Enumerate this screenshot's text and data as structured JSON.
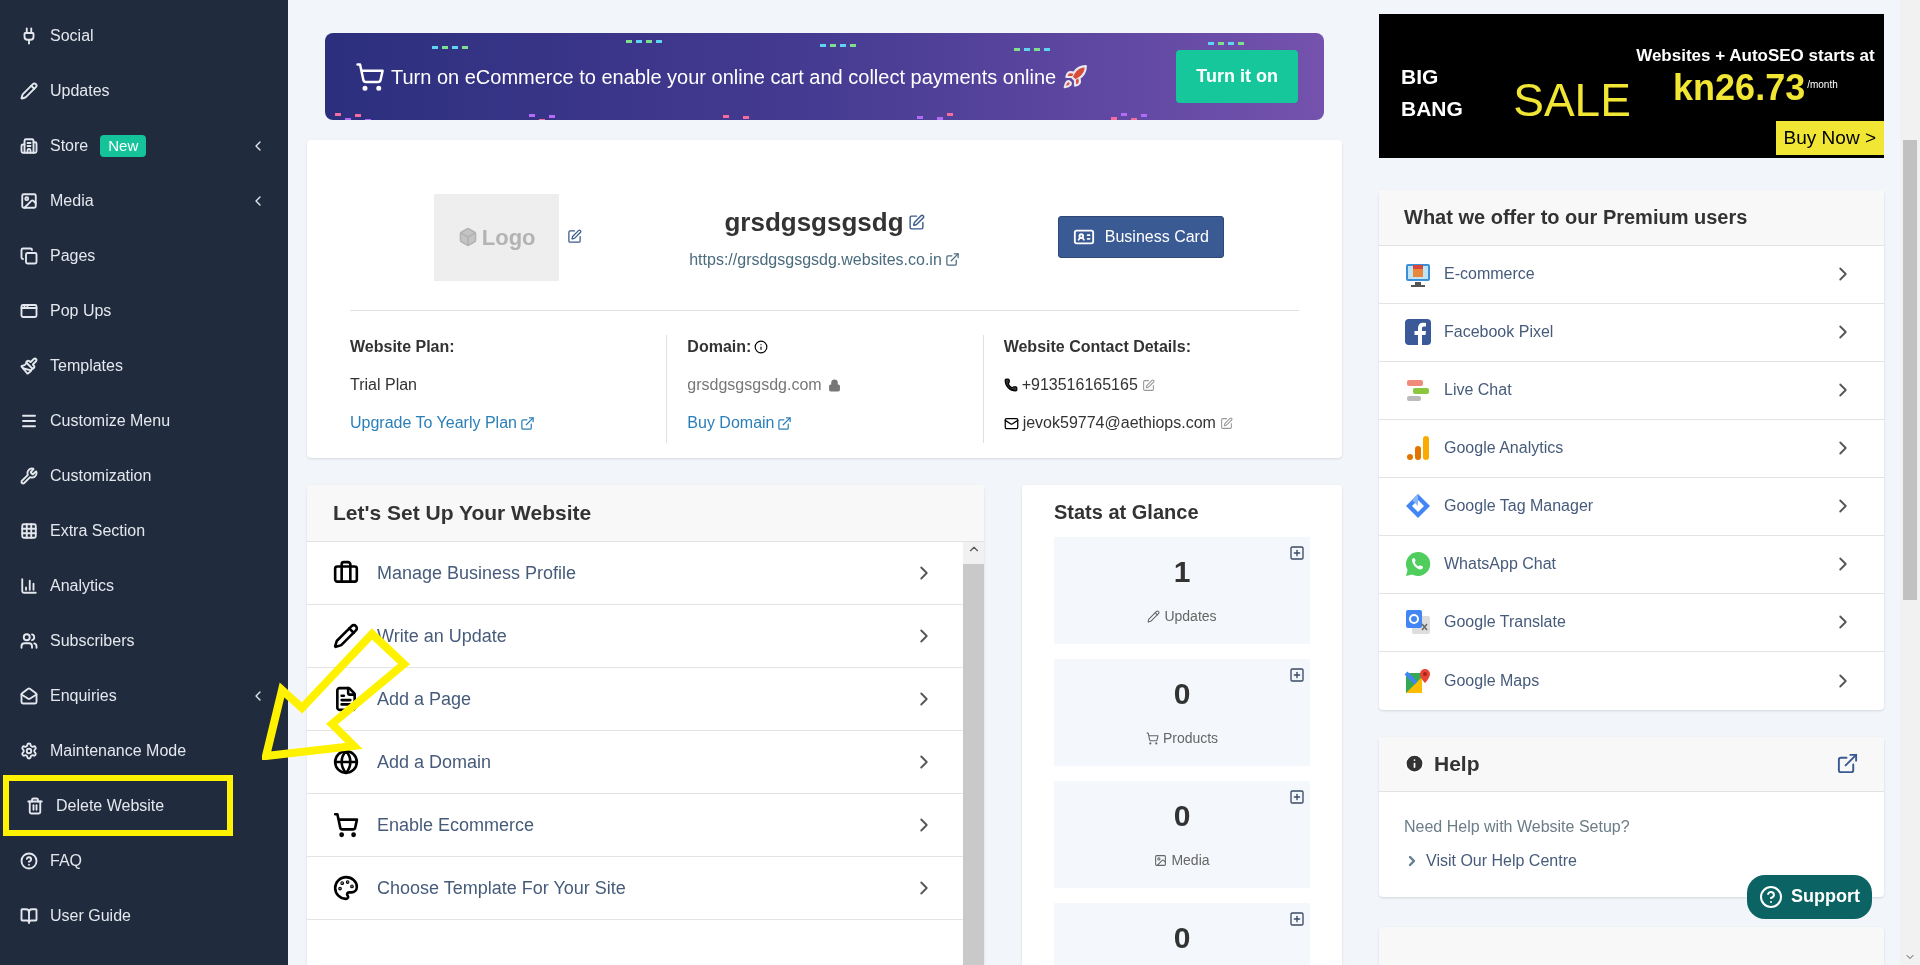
{
  "sidebar": {
    "items": [
      {
        "label": "Social",
        "has_submenu": false,
        "highlighted": false
      },
      {
        "label": "Updates",
        "has_submenu": false,
        "highlighted": false
      },
      {
        "label": "Store",
        "badge": "New",
        "has_submenu": true,
        "highlighted": false
      },
      {
        "label": "Media",
        "has_submenu": true,
        "highlighted": false
      },
      {
        "label": "Pages",
        "has_submenu": false,
        "highlighted": false
      },
      {
        "label": "Pop Ups",
        "has_submenu": false,
        "highlighted": false
      },
      {
        "label": "Templates",
        "has_submenu": false,
        "highlighted": false
      },
      {
        "label": "Customize Menu",
        "has_submenu": false,
        "highlighted": false
      },
      {
        "label": "Customization",
        "has_submenu": false,
        "highlighted": false
      },
      {
        "label": "Extra Section",
        "has_submenu": false,
        "highlighted": false
      },
      {
        "label": "Analytics",
        "has_submenu": false,
        "highlighted": false
      },
      {
        "label": "Subscribers",
        "has_submenu": false,
        "highlighted": false
      },
      {
        "label": "Enquiries",
        "has_submenu": true,
        "highlighted": false
      },
      {
        "label": "Maintenance Mode",
        "has_submenu": false,
        "highlighted": false
      },
      {
        "label": "Delete Website",
        "has_submenu": false,
        "highlighted": true
      },
      {
        "label": "FAQ",
        "has_submenu": false,
        "highlighted": false
      },
      {
        "label": "User Guide",
        "has_submenu": false,
        "highlighted": false
      }
    ]
  },
  "ecommerce_banner": {
    "text": "Turn on eCommerce to enable your online cart and collect payments online",
    "button": "Turn it on"
  },
  "site_card": {
    "logo": "Logo",
    "name": "grsdgsgsgsdg",
    "url": "https://grsdgsgsgsdg.websites.co.in",
    "button": "Business Card",
    "plan": {
      "label": "Website Plan:",
      "value": "Trial Plan",
      "link": "Upgrade To Yearly Plan"
    },
    "domain": {
      "label": "Domain:",
      "value": "grsdgsgsgsdg.com",
      "link": "Buy Domain"
    },
    "contact": {
      "label": "Website Contact Details:",
      "phone": "+913516165165",
      "email": "jevok59774@aethiops.com"
    }
  },
  "setup": {
    "title": "Let's Set Up Your Website",
    "items": [
      "Manage Business Profile",
      "Write an Update",
      "Add a Page",
      "Add a Domain",
      "Enable Ecommerce",
      "Choose Template For Your Site"
    ]
  },
  "stats": {
    "title": "Stats at Glance",
    "items": [
      {
        "value": "1",
        "label": "Updates"
      },
      {
        "value": "0",
        "label": "Products"
      },
      {
        "value": "0",
        "label": "Media"
      },
      {
        "value": "0"
      }
    ]
  },
  "ad": {
    "brand": "BIG BANG",
    "sale": "SALE",
    "headline": "Websites + AutoSEO starts at",
    "price": "kn26.73",
    "period": "/month",
    "button": "Buy Now >"
  },
  "premium": {
    "title": "What we offer to our Premium users",
    "items": [
      "E-commerce",
      "Facebook Pixel",
      "Live Chat",
      "Google Analytics",
      "Google Tag Manager",
      "WhatsApp Chat",
      "Google Translate",
      "Google Maps"
    ]
  },
  "help": {
    "title": "Help",
    "text": "Need Help with Website Setup?",
    "link": "Visit Our Help Centre"
  },
  "support_button": "Support"
}
